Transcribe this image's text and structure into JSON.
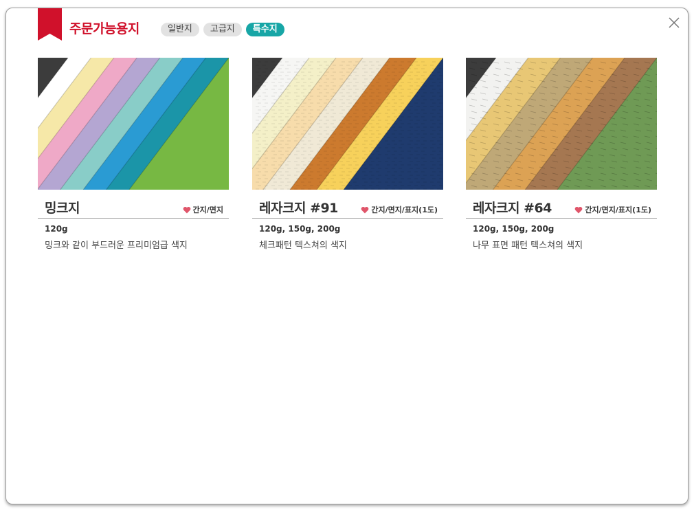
{
  "header": {
    "title": "주문가능용지"
  },
  "tabs": [
    {
      "label": "일반지",
      "active": false
    },
    {
      "label": "고급지",
      "active": false
    },
    {
      "label": "특수지",
      "active": true
    }
  ],
  "colors": {
    "brand": "#d0112b",
    "accent": "#17a6a6",
    "heart": "#e0556a"
  },
  "cards": [
    {
      "name": "밍크지",
      "usage": "간지/면지",
      "weight": "120g",
      "description": "밍크와 같이 부드러운 프리미엄급 색지",
      "texture": "smooth",
      "swatch_colors": [
        "#ffffff",
        "#f6e8a8",
        "#efa9c7",
        "#b4a6d2",
        "#89cdc8",
        "#2a9bd3",
        "#1b95a8",
        "#77b843"
      ]
    },
    {
      "name": "레자크지 #91",
      "usage": "간지/면지/표지(1도)",
      "weight": "120g, 150g, 200g",
      "description": "체크패턴 텍스쳐의 색지",
      "texture": "check",
      "swatch_colors": [
        "#f6f6f4",
        "#f4f0c8",
        "#f7dcab",
        "#f0e9d6",
        "#cc7a2e",
        "#f7d15b",
        "#1f3b6e"
      ]
    },
    {
      "name": "레자크지 #64",
      "usage": "간지/면지/표지(1도)",
      "weight": "120g, 150g, 200g",
      "description": "나무 표면 패턴 텍스쳐의 색지",
      "texture": "bark",
      "swatch_colors": [
        "#f2f2f0",
        "#e8c775",
        "#bfa877",
        "#dca254",
        "#a57751",
        "#6f9a55"
      ]
    }
  ]
}
